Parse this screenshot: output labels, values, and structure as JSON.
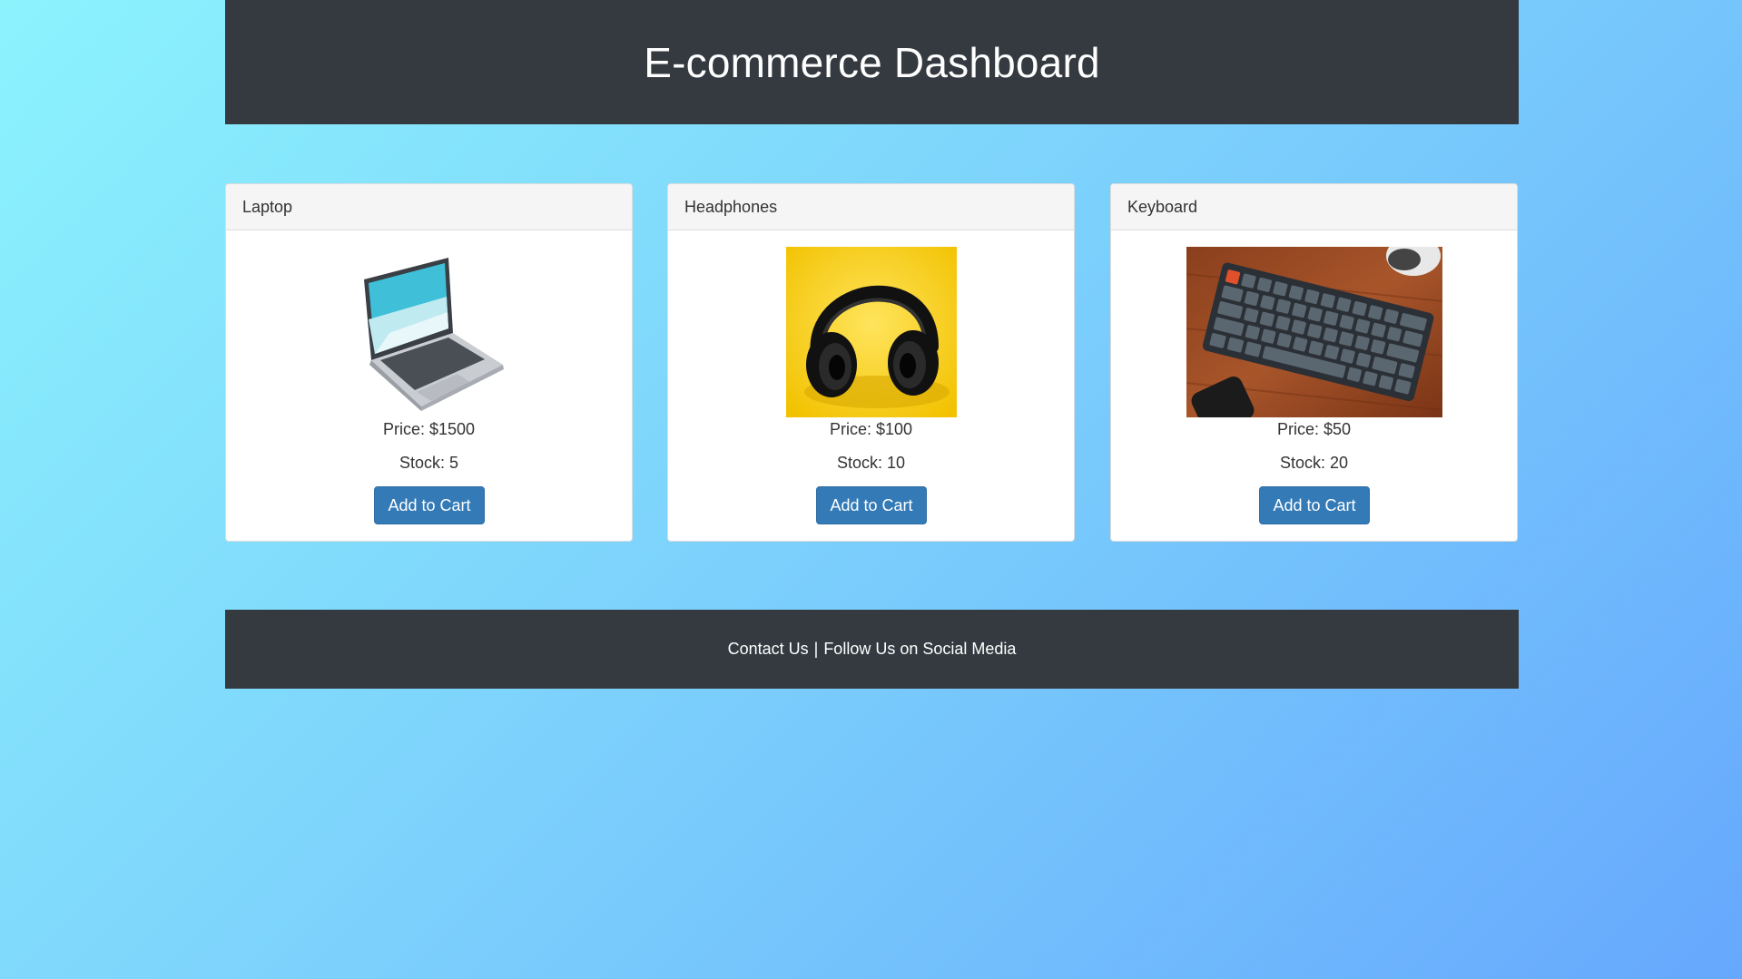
{
  "header": {
    "title": "E-commerce Dashboard"
  },
  "products": [
    {
      "name": "Laptop",
      "price_text": "Price: $1500",
      "stock_text": "Stock: 5",
      "button_label": "Add to Cart",
      "image_icon": "laptop-image"
    },
    {
      "name": "Headphones",
      "price_text": "Price: $100",
      "stock_text": "Stock: 10",
      "button_label": "Add to Cart",
      "image_icon": "headphones-image"
    },
    {
      "name": "Keyboard",
      "price_text": "Price: $50",
      "stock_text": "Stock: 20",
      "button_label": "Add to Cart",
      "image_icon": "keyboard-image"
    }
  ],
  "footer": {
    "contact_label": "Contact Us",
    "separator": "|",
    "social_label": "Follow Us on Social Media"
  },
  "colors": {
    "header_bg": "#343a40",
    "button_bg": "#337ab7",
    "gradient_start": "#8cf3fd",
    "gradient_end": "#66a8fd"
  }
}
